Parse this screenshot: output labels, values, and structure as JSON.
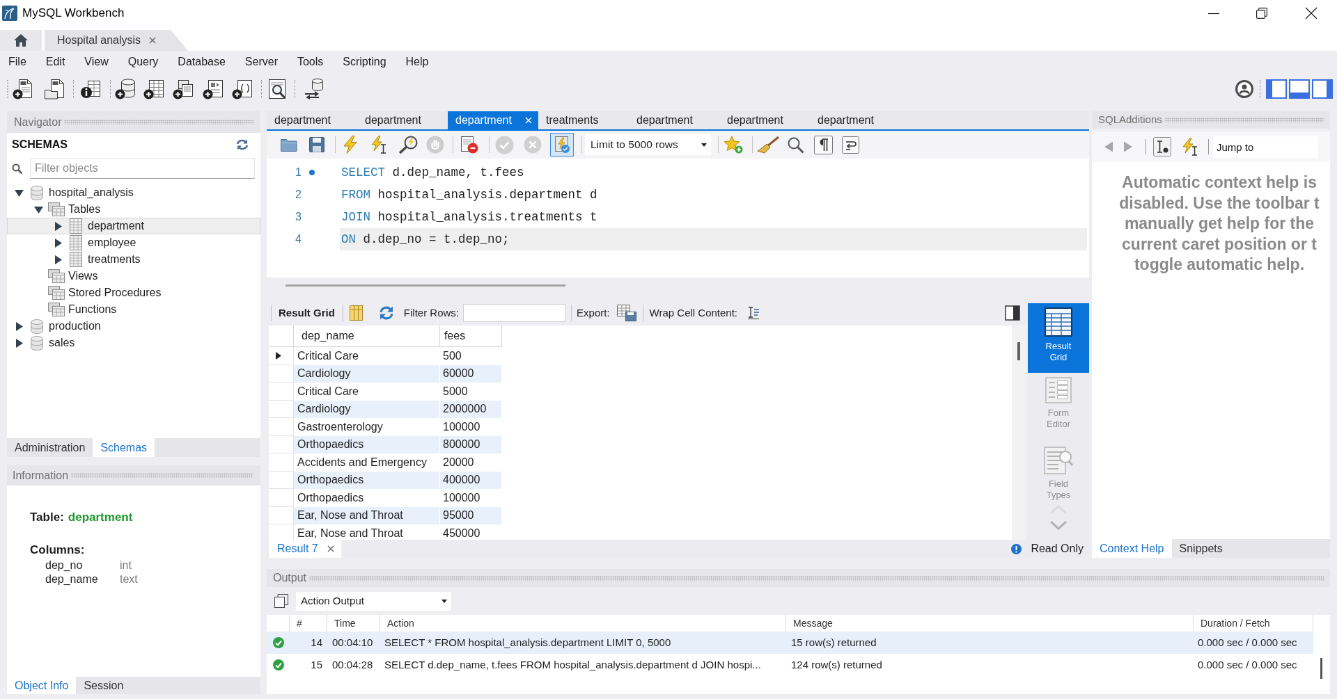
{
  "window": {
    "title": "MySQL Workbench"
  },
  "connection_tabs": [
    {
      "label": "Hospital analysis",
      "selected": true
    }
  ],
  "menu": [
    "File",
    "Edit",
    "View",
    "Query",
    "Database",
    "Server",
    "Tools",
    "Scripting",
    "Help"
  ],
  "layout_toggles": [
    {
      "kind": "left",
      "on": true
    },
    {
      "kind": "bottom",
      "on": true
    },
    {
      "kind": "right",
      "on": true
    }
  ],
  "navigator": {
    "title": "Navigator",
    "heading": "SCHEMAS",
    "filter": {
      "placeholder": "Filter objects"
    },
    "tree": [
      {
        "label": "hospital_analysis",
        "kind": "schema",
        "expanded": true,
        "children": [
          {
            "label": "Tables",
            "kind": "folder",
            "expanded": true,
            "children": [
              {
                "label": "department",
                "kind": "table",
                "expanded": false,
                "selected": true
              },
              {
                "label": "employee",
                "kind": "table",
                "expanded": false,
                "selected": false
              },
              {
                "label": "treatments",
                "kind": "table",
                "expanded": false,
                "selected": false
              }
            ]
          },
          {
            "label": "Views",
            "kind": "folder"
          },
          {
            "label": "Stored Procedures",
            "kind": "folder"
          },
          {
            "label": "Functions",
            "kind": "folder"
          }
        ]
      },
      {
        "label": "production",
        "kind": "schema",
        "expanded": false
      },
      {
        "label": "sales",
        "kind": "schema",
        "expanded": false
      }
    ],
    "tabs": [
      {
        "label": "Administration",
        "selected": false
      },
      {
        "label": "Schemas",
        "selected": true
      }
    ]
  },
  "information": {
    "title": "Information",
    "object_label": "Table:",
    "object_name": "department",
    "columns_heading": "Columns:",
    "columns": [
      {
        "name": "dep_no",
        "type": "int"
      },
      {
        "name": "dep_name",
        "type": "text"
      }
    ],
    "tabs": [
      {
        "label": "Object Info",
        "selected": true
      },
      {
        "label": "Session",
        "selected": false
      }
    ]
  },
  "editor_tabs": [
    {
      "label": "department",
      "selected": false
    },
    {
      "label": "department",
      "selected": false
    },
    {
      "label": "department",
      "selected": true
    },
    {
      "label": "treatments",
      "selected": false
    },
    {
      "label": "department",
      "selected": false
    },
    {
      "label": "department",
      "selected": false
    },
    {
      "label": "department",
      "selected": false
    }
  ],
  "sql_toolbar": {
    "toggle_pressed": true,
    "limit": "Limit to 5000 rows"
  },
  "code": [
    {
      "number": "1",
      "keyword": "SELECT",
      "text": "d.dep_name, t.fees",
      "marker": true,
      "current": false
    },
    {
      "number": "2",
      "keyword": "FROM",
      "text": "hospital_analysis.department d",
      "marker": false,
      "current": false
    },
    {
      "number": "3",
      "keyword": "JOIN",
      "text": "hospital_analysis.treatments t",
      "marker": false,
      "current": false
    },
    {
      "number": "4",
      "keyword": "ON",
      "text": "d.dep_no = t.dep_no;",
      "marker": false,
      "current": true
    }
  ],
  "result_toolbar": {
    "title": "Result Grid",
    "filter_label": "Filter Rows:",
    "export_label": "Export:",
    "wrap_label": "Wrap Cell Content:"
  },
  "result_grid": {
    "columns": [
      "dep_name",
      "fees"
    ],
    "rows": [
      {
        "cells": [
          "Critical Care",
          "500"
        ],
        "selected": true
      },
      {
        "cells": [
          "Cardiology",
          "60000"
        ],
        "selected": false
      },
      {
        "cells": [
          "Critical Care",
          "5000"
        ],
        "selected": false
      },
      {
        "cells": [
          "Cardiology",
          "2000000"
        ],
        "selected": false
      },
      {
        "cells": [
          "Gastroenterology",
          "100000"
        ],
        "selected": false
      },
      {
        "cells": [
          "Orthopaedics",
          "800000"
        ],
        "selected": false
      },
      {
        "cells": [
          "Accidents and Emergency",
          "20000"
        ],
        "selected": false
      },
      {
        "cells": [
          "Orthopaedics",
          "400000"
        ],
        "selected": false
      },
      {
        "cells": [
          "Orthopaedics",
          "100000"
        ],
        "selected": false
      },
      {
        "cells": [
          "Ear, Nose and Throat",
          "95000"
        ],
        "selected": false
      },
      {
        "cells": [
          "Ear, Nose and Throat",
          "450000"
        ],
        "selected": false
      }
    ]
  },
  "result_views": [
    {
      "label": "Result Grid",
      "kind": "grid",
      "selected": true
    },
    {
      "label": "Form Editor",
      "kind": "form",
      "selected": false
    },
    {
      "label": "Field Types",
      "kind": "fields",
      "selected": false
    }
  ],
  "result_tabs": [
    {
      "label": "Result 7",
      "selected": true
    }
  ],
  "result_status": "Read Only",
  "sql_additions": {
    "title": "SQLAdditions",
    "jump_to": "Jump to",
    "help_text": [
      "Automatic context help is",
      "disabled. Use the toolbar t",
      "manually get help for the",
      "current caret position or t",
      "toggle automatic help."
    ],
    "tabs": [
      {
        "label": "Context Help",
        "selected": true
      },
      {
        "label": "Snippets",
        "selected": false
      }
    ]
  },
  "output": {
    "title": "Output",
    "mode": "Action Output",
    "columns": [
      "#",
      "Time",
      "Action",
      "Message",
      "Duration / Fetch"
    ],
    "rows": [
      {
        "kind": "success",
        "number": "14",
        "time": "00:04:10",
        "action": "SELECT * FROM hospital_analysis.department LIMIT 0, 5000",
        "message": "15 row(s) returned",
        "duration": "0.000 sec / 0.000 sec"
      },
      {
        "kind": "success",
        "number": "15",
        "time": "00:04:28",
        "action": "SELECT d.dep_name, t.fees FROM hospital_analysis.department d JOIN hospi...",
        "message": "124 row(s) returned",
        "duration": "0.000 sec / 0.000 sec"
      }
    ]
  }
}
